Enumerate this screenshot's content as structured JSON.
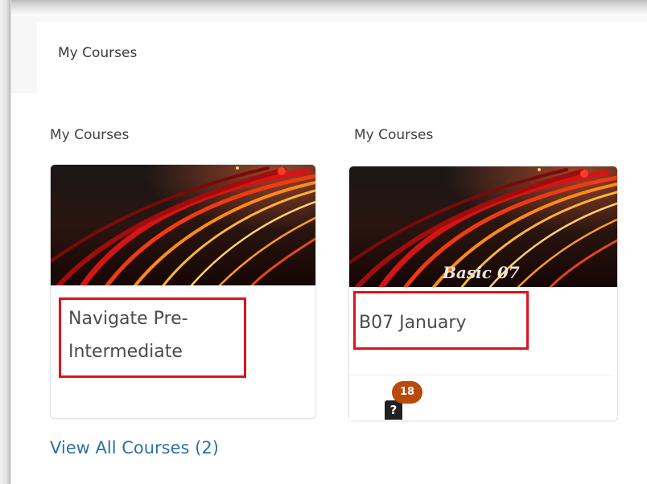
{
  "header": {
    "title": "My Courses"
  },
  "columns": [
    {
      "title": "My Courses",
      "course": {
        "name_line1": "Navigate Pre-",
        "name_line2": "Intermediate",
        "image_caption": ""
      }
    },
    {
      "title": "My Courses",
      "course": {
        "name_line1": "B07 January",
        "image_caption": "Basic 07",
        "notification_count": "18",
        "notification_icon": "question-icon"
      }
    }
  ],
  "footer": {
    "view_all_label": "View All Courses (2)"
  },
  "colors": {
    "highlight": "#e0121c",
    "link": "#2b70a8",
    "badge": "#b84a0e"
  }
}
